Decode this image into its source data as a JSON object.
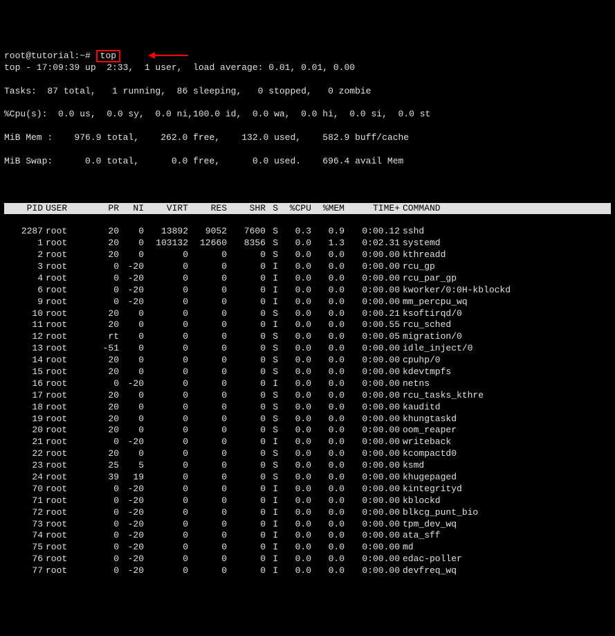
{
  "prompt": {
    "user_host": "root@tutorial",
    "path": "~",
    "separator": "#",
    "command": "top"
  },
  "summary": {
    "line1": "top - 17:09:39 up  2:33,  1 user,  load average: 0.01, 0.01, 0.00",
    "line2": "Tasks:  87 total,   1 running,  86 sleeping,   0 stopped,   0 zombie",
    "line3": "%Cpu(s):  0.0 us,  0.0 sy,  0.0 ni,100.0 id,  0.0 wa,  0.0 hi,  0.0 si,  0.0 st",
    "line4": "MiB Mem :    976.9 total,    262.0 free,    132.0 used,    582.9 buff/cache",
    "line5": "MiB Swap:      0.0 total,      0.0 free,      0.0 used.    696.4 avail Mem"
  },
  "columns": {
    "pid": "PID",
    "user": "USER",
    "pr": "PR",
    "ni": "NI",
    "virt": "VIRT",
    "res": "RES",
    "shr": "SHR",
    "s": "S",
    "cpu": "%CPU",
    "mem": "%MEM",
    "time": "TIME+",
    "cmd": "COMMAND"
  },
  "processes": [
    {
      "pid": "2287",
      "user": "root",
      "pr": "20",
      "ni": "0",
      "virt": "13892",
      "res": "9052",
      "shr": "7600",
      "s": "S",
      "cpu": "0.3",
      "mem": "0.9",
      "time": "0:00.12",
      "cmd": "sshd"
    },
    {
      "pid": "1",
      "user": "root",
      "pr": "20",
      "ni": "0",
      "virt": "103132",
      "res": "12660",
      "shr": "8356",
      "s": "S",
      "cpu": "0.0",
      "mem": "1.3",
      "time": "0:02.31",
      "cmd": "systemd"
    },
    {
      "pid": "2",
      "user": "root",
      "pr": "20",
      "ni": "0",
      "virt": "0",
      "res": "0",
      "shr": "0",
      "s": "S",
      "cpu": "0.0",
      "mem": "0.0",
      "time": "0:00.00",
      "cmd": "kthreadd"
    },
    {
      "pid": "3",
      "user": "root",
      "pr": "0",
      "ni": "-20",
      "virt": "0",
      "res": "0",
      "shr": "0",
      "s": "I",
      "cpu": "0.0",
      "mem": "0.0",
      "time": "0:00.00",
      "cmd": "rcu_gp"
    },
    {
      "pid": "4",
      "user": "root",
      "pr": "0",
      "ni": "-20",
      "virt": "0",
      "res": "0",
      "shr": "0",
      "s": "I",
      "cpu": "0.0",
      "mem": "0.0",
      "time": "0:00.00",
      "cmd": "rcu_par_gp"
    },
    {
      "pid": "6",
      "user": "root",
      "pr": "0",
      "ni": "-20",
      "virt": "0",
      "res": "0",
      "shr": "0",
      "s": "I",
      "cpu": "0.0",
      "mem": "0.0",
      "time": "0:00.00",
      "cmd": "kworker/0:0H-kblockd"
    },
    {
      "pid": "9",
      "user": "root",
      "pr": "0",
      "ni": "-20",
      "virt": "0",
      "res": "0",
      "shr": "0",
      "s": "I",
      "cpu": "0.0",
      "mem": "0.0",
      "time": "0:00.00",
      "cmd": "mm_percpu_wq"
    },
    {
      "pid": "10",
      "user": "root",
      "pr": "20",
      "ni": "0",
      "virt": "0",
      "res": "0",
      "shr": "0",
      "s": "S",
      "cpu": "0.0",
      "mem": "0.0",
      "time": "0:00.21",
      "cmd": "ksoftirqd/0"
    },
    {
      "pid": "11",
      "user": "root",
      "pr": "20",
      "ni": "0",
      "virt": "0",
      "res": "0",
      "shr": "0",
      "s": "I",
      "cpu": "0.0",
      "mem": "0.0",
      "time": "0:00.55",
      "cmd": "rcu_sched"
    },
    {
      "pid": "12",
      "user": "root",
      "pr": "rt",
      "ni": "0",
      "virt": "0",
      "res": "0",
      "shr": "0",
      "s": "S",
      "cpu": "0.0",
      "mem": "0.0",
      "time": "0:00.05",
      "cmd": "migration/0"
    },
    {
      "pid": "13",
      "user": "root",
      "pr": "-51",
      "ni": "0",
      "virt": "0",
      "res": "0",
      "shr": "0",
      "s": "S",
      "cpu": "0.0",
      "mem": "0.0",
      "time": "0:00.00",
      "cmd": "idle_inject/0"
    },
    {
      "pid": "14",
      "user": "root",
      "pr": "20",
      "ni": "0",
      "virt": "0",
      "res": "0",
      "shr": "0",
      "s": "S",
      "cpu": "0.0",
      "mem": "0.0",
      "time": "0:00.00",
      "cmd": "cpuhp/0"
    },
    {
      "pid": "15",
      "user": "root",
      "pr": "20",
      "ni": "0",
      "virt": "0",
      "res": "0",
      "shr": "0",
      "s": "S",
      "cpu": "0.0",
      "mem": "0.0",
      "time": "0:00.00",
      "cmd": "kdevtmpfs"
    },
    {
      "pid": "16",
      "user": "root",
      "pr": "0",
      "ni": "-20",
      "virt": "0",
      "res": "0",
      "shr": "0",
      "s": "I",
      "cpu": "0.0",
      "mem": "0.0",
      "time": "0:00.00",
      "cmd": "netns"
    },
    {
      "pid": "17",
      "user": "root",
      "pr": "20",
      "ni": "0",
      "virt": "0",
      "res": "0",
      "shr": "0",
      "s": "S",
      "cpu": "0.0",
      "mem": "0.0",
      "time": "0:00.00",
      "cmd": "rcu_tasks_kthre"
    },
    {
      "pid": "18",
      "user": "root",
      "pr": "20",
      "ni": "0",
      "virt": "0",
      "res": "0",
      "shr": "0",
      "s": "S",
      "cpu": "0.0",
      "mem": "0.0",
      "time": "0:00.00",
      "cmd": "kauditd"
    },
    {
      "pid": "19",
      "user": "root",
      "pr": "20",
      "ni": "0",
      "virt": "0",
      "res": "0",
      "shr": "0",
      "s": "S",
      "cpu": "0.0",
      "mem": "0.0",
      "time": "0:00.00",
      "cmd": "khungtaskd"
    },
    {
      "pid": "20",
      "user": "root",
      "pr": "20",
      "ni": "0",
      "virt": "0",
      "res": "0",
      "shr": "0",
      "s": "S",
      "cpu": "0.0",
      "mem": "0.0",
      "time": "0:00.00",
      "cmd": "oom_reaper"
    },
    {
      "pid": "21",
      "user": "root",
      "pr": "0",
      "ni": "-20",
      "virt": "0",
      "res": "0",
      "shr": "0",
      "s": "I",
      "cpu": "0.0",
      "mem": "0.0",
      "time": "0:00.00",
      "cmd": "writeback"
    },
    {
      "pid": "22",
      "user": "root",
      "pr": "20",
      "ni": "0",
      "virt": "0",
      "res": "0",
      "shr": "0",
      "s": "S",
      "cpu": "0.0",
      "mem": "0.0",
      "time": "0:00.00",
      "cmd": "kcompactd0"
    },
    {
      "pid": "23",
      "user": "root",
      "pr": "25",
      "ni": "5",
      "virt": "0",
      "res": "0",
      "shr": "0",
      "s": "S",
      "cpu": "0.0",
      "mem": "0.0",
      "time": "0:00.00",
      "cmd": "ksmd"
    },
    {
      "pid": "24",
      "user": "root",
      "pr": "39",
      "ni": "19",
      "virt": "0",
      "res": "0",
      "shr": "0",
      "s": "S",
      "cpu": "0.0",
      "mem": "0.0",
      "time": "0:00.00",
      "cmd": "khugepaged"
    },
    {
      "pid": "70",
      "user": "root",
      "pr": "0",
      "ni": "-20",
      "virt": "0",
      "res": "0",
      "shr": "0",
      "s": "I",
      "cpu": "0.0",
      "mem": "0.0",
      "time": "0:00.00",
      "cmd": "kintegrityd"
    },
    {
      "pid": "71",
      "user": "root",
      "pr": "0",
      "ni": "-20",
      "virt": "0",
      "res": "0",
      "shr": "0",
      "s": "I",
      "cpu": "0.0",
      "mem": "0.0",
      "time": "0:00.00",
      "cmd": "kblockd"
    },
    {
      "pid": "72",
      "user": "root",
      "pr": "0",
      "ni": "-20",
      "virt": "0",
      "res": "0",
      "shr": "0",
      "s": "I",
      "cpu": "0.0",
      "mem": "0.0",
      "time": "0:00.00",
      "cmd": "blkcg_punt_bio"
    },
    {
      "pid": "73",
      "user": "root",
      "pr": "0",
      "ni": "-20",
      "virt": "0",
      "res": "0",
      "shr": "0",
      "s": "I",
      "cpu": "0.0",
      "mem": "0.0",
      "time": "0:00.00",
      "cmd": "tpm_dev_wq"
    },
    {
      "pid": "74",
      "user": "root",
      "pr": "0",
      "ni": "-20",
      "virt": "0",
      "res": "0",
      "shr": "0",
      "s": "I",
      "cpu": "0.0",
      "mem": "0.0",
      "time": "0:00.00",
      "cmd": "ata_sff"
    },
    {
      "pid": "75",
      "user": "root",
      "pr": "0",
      "ni": "-20",
      "virt": "0",
      "res": "0",
      "shr": "0",
      "s": "I",
      "cpu": "0.0",
      "mem": "0.0",
      "time": "0:00.00",
      "cmd": "md"
    },
    {
      "pid": "76",
      "user": "root",
      "pr": "0",
      "ni": "-20",
      "virt": "0",
      "res": "0",
      "shr": "0",
      "s": "I",
      "cpu": "0.0",
      "mem": "0.0",
      "time": "0:00.00",
      "cmd": "edac-poller"
    },
    {
      "pid": "77",
      "user": "root",
      "pr": "0",
      "ni": "-20",
      "virt": "0",
      "res": "0",
      "shr": "0",
      "s": "I",
      "cpu": "0.0",
      "mem": "0.0",
      "time": "0:00.00",
      "cmd": "devfreq_wq"
    }
  ]
}
